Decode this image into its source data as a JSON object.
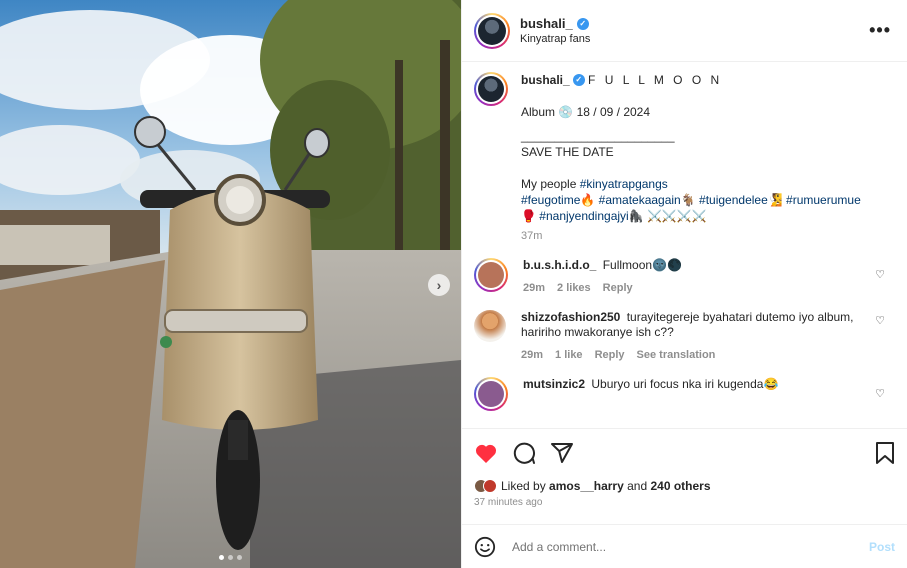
{
  "post": {
    "username": "bushali_",
    "location": "Kinyatrap fans",
    "more_label": "•••",
    "verified_glyph": "✓",
    "carousel_next": "›"
  },
  "caption": {
    "username": "bushali_",
    "title": "F U L L M O O N",
    "album_line": "Album 💿 18 / 09 / 2024",
    "divider": "_______________________",
    "save_the_date": "SAVE THE DATE",
    "body_prefix": "My people ",
    "tags": [
      "#kinyatrapgangs",
      "#feugotime🔥",
      "#amatekaagain🐐",
      "#tuigendelee🧏",
      "#rumuerumue",
      "🥊",
      "#nanjyendingajyi🦍",
      "⚔️⚔️⚔️⚔️"
    ],
    "time": "37m"
  },
  "comments": [
    {
      "username": "b.u.s.h.i.d.o_",
      "text": "Fullmoon🌚🌑",
      "time": "29m",
      "likes": "2 likes",
      "reply": "Reply",
      "translate": "",
      "avatar_color": "#b7735a"
    },
    {
      "username": "shizzofashion250",
      "text": "turayitegereje byahatari dutemo iyo album, haririho mwakoranye ish c??",
      "time": "29m",
      "likes": "1 like",
      "reply": "Reply",
      "translate": "See translation",
      "avatar_color": "#c27a45"
    },
    {
      "username": "mutsinzic2",
      "text": "Uburyo uri focus nka iri kugenda😂",
      "time": "",
      "likes": "",
      "reply": "",
      "translate": "",
      "avatar_color": "#8a5b8f"
    }
  ],
  "likes": {
    "prefix": "Liked by",
    "user": "amos__harry",
    "and_text": "and",
    "others": "240 others",
    "ago": "37 minutes ago"
  },
  "add_comment": {
    "placeholder": "Add a comment...",
    "post_label": "Post"
  },
  "colors": {
    "like_active": "#ff3040",
    "verified": "#3897f0",
    "hashtag": "#00376b",
    "post_disabled": "#b2dffc"
  },
  "carousel": {
    "count": 3,
    "active_index": 0
  }
}
